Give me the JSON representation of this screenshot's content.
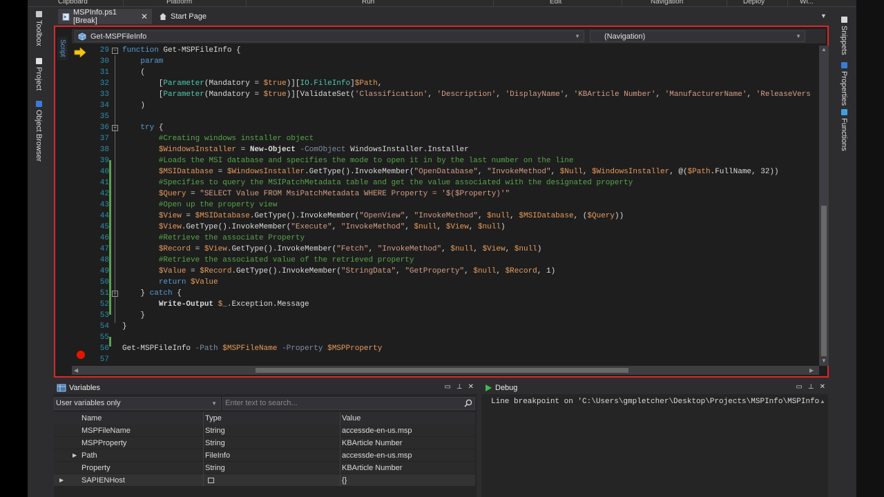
{
  "ribbon": {
    "groups": [
      "Clipboard",
      "Platform",
      "Run",
      "Edit",
      "Navigation",
      "Deploy",
      "Wi..."
    ]
  },
  "tabs": [
    {
      "label": "MSPInfo.ps1 [Break]",
      "active": true
    },
    {
      "label": "Start Page",
      "active": false
    }
  ],
  "left_dock": [
    "Toolbox",
    "Project",
    "Object Browser"
  ],
  "right_dock": [
    "Snippets",
    "Properties",
    "Functions"
  ],
  "editor": {
    "side_tab": "Script",
    "function_dropdown": "Get-MSPFileInfo",
    "navigation_dropdown": "(Navigation)",
    "lines": [
      {
        "n": "29",
        "text": "function Get-MSPFileInfo {"
      },
      {
        "n": "30",
        "text": "    param"
      },
      {
        "n": "31",
        "text": "    ("
      },
      {
        "n": "32",
        "text": "        [Parameter(Mandatory = $true)][IO.FileInfo]$Path,"
      },
      {
        "n": "33",
        "text": "        [Parameter(Mandatory = $true)][ValidateSet('Classification', 'Description', 'DisplayName', 'KBArticle Number', 'ManufacturerName', 'ReleaseVers"
      },
      {
        "n": "34",
        "text": "    )"
      },
      {
        "n": "35",
        "text": ""
      },
      {
        "n": "36",
        "text": "    try {"
      },
      {
        "n": "37",
        "text": "        #Creating windows installer object"
      },
      {
        "n": "38",
        "text": "        $WindowsInstaller = New-Object -ComObject WindowsInstaller.Installer"
      },
      {
        "n": "39",
        "text": "        #Loads the MSI database and specifies the mode to open it in by the last number on the line"
      },
      {
        "n": "40",
        "text": "        $MSIDatabase = $WindowsInstaller.GetType().InvokeMember(\"OpenDatabase\", \"InvokeMethod\", $Null, $WindowsInstaller, @($Path.FullName, 32))"
      },
      {
        "n": "41",
        "text": "        #Specifies to query the MSIPatchMetadata table and get the value associated with the designated property"
      },
      {
        "n": "42",
        "text": "        $Query = \"SELECT Value FROM MsiPatchMetadata WHERE Property = '$($Property)'\""
      },
      {
        "n": "43",
        "text": "        #Open up the property view"
      },
      {
        "n": "44",
        "text": "        $View = $MSIDatabase.GetType().InvokeMember(\"OpenView\", \"InvokeMethod\", $null, $MSIDatabase, ($Query))"
      },
      {
        "n": "45",
        "text": "        $View.GetType().InvokeMember(\"Execute\", \"InvokeMethod\", $null, $View, $null)"
      },
      {
        "n": "46",
        "text": "        #Retrieve the associate Property"
      },
      {
        "n": "47",
        "text": "        $Record = $View.GetType().InvokeMember(\"Fetch\", \"InvokeMethod\", $null, $View, $null)"
      },
      {
        "n": "48",
        "text": "        #Retrieve the associated value of the retrieved property"
      },
      {
        "n": "49",
        "text": "        $Value = $Record.GetType().InvokeMember(\"StringData\", \"GetProperty\", $null, $Record, 1)"
      },
      {
        "n": "50",
        "text": "        return $Value"
      },
      {
        "n": "51",
        "text": "    } catch {"
      },
      {
        "n": "52",
        "text": "        Write-Output $_.Exception.Message"
      },
      {
        "n": "53",
        "text": "    }"
      },
      {
        "n": "54",
        "text": "}"
      },
      {
        "n": "55",
        "text": ""
      },
      {
        "n": "56",
        "text": "Get-MSPFileInfo -Path $MSPFileName -Property $MSPProperty"
      },
      {
        "n": "57",
        "text": ""
      }
    ]
  },
  "variables_panel": {
    "title": "Variables",
    "filter": "User variables only",
    "search_placeholder": "Enter text to search...",
    "columns": [
      "Name",
      "Type",
      "Value"
    ],
    "rows": [
      {
        "name": "MSPFileName",
        "type": "String",
        "value": "accessde-en-us.msp"
      },
      {
        "name": "MSPProperty",
        "type": "String",
        "value": "KBArticle Number"
      },
      {
        "name": "Path",
        "type": "FileInfo",
        "value": "accessde-en-us.msp"
      },
      {
        "name": "Property",
        "type": "String",
        "value": "KBArticle Number"
      },
      {
        "name": "SAPIENHost",
        "type": "",
        "value": "{}"
      }
    ]
  },
  "debug_panel": {
    "title": "Debug",
    "output": "Line breakpoint on 'C:\\Users\\gmpletcher\\Desktop\\Projects\\MSPInfo\\MSPInfo"
  },
  "colors": {
    "accent_red": "#e0262a",
    "keyword": "#569cd6",
    "comment": "#57a64a",
    "variable": "#e69a5c",
    "string": "#d69d85",
    "line_number": "#2b91af",
    "breakpoint": "#e51400",
    "exec_arrow": "#f5c518"
  }
}
